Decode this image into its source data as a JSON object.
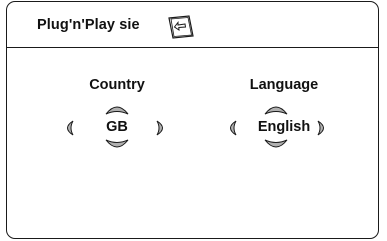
{
  "header": {
    "title": "Plug'n'Play sie",
    "page_icon": "page-corner-arrow-icon"
  },
  "settings": {
    "country": {
      "label": "Country",
      "value": "GB"
    },
    "language": {
      "label": "Language",
      "value": "English"
    }
  },
  "colors": {
    "border": "#1a1a1a",
    "arrow_fill": "#b0b0b0",
    "background": "#ffffff"
  }
}
